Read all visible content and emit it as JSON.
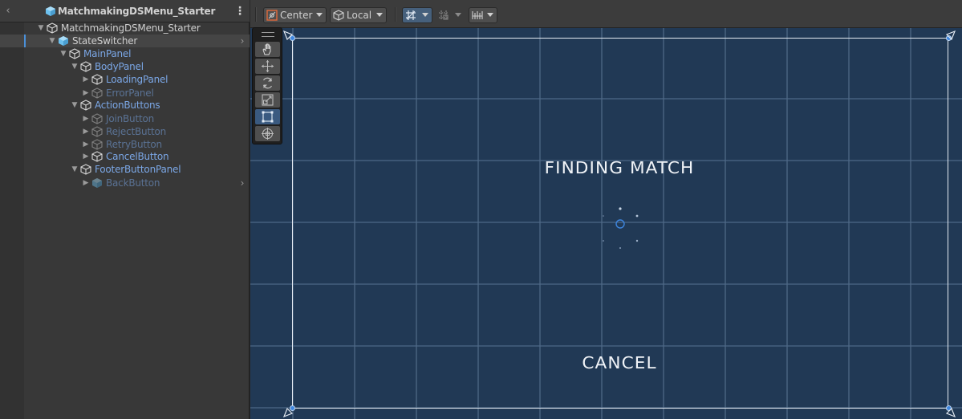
{
  "hierarchy": {
    "title": "MatchmakingDSMenu_Starter",
    "items": [
      {
        "label": "MatchmakingDSMenu_Starter",
        "depth": 0,
        "expanded": true,
        "color": "white",
        "icon": "gameobject-icon"
      },
      {
        "label": "StateSwitcher",
        "depth": 1,
        "expanded": true,
        "color": "white",
        "icon": "prefab-icon",
        "selected": true
      },
      {
        "label": "MainPanel",
        "depth": 2,
        "expanded": true,
        "color": "blue",
        "icon": "gameobject-icon"
      },
      {
        "label": "BodyPanel",
        "depth": 3,
        "expanded": true,
        "color": "blue",
        "icon": "gameobject-icon"
      },
      {
        "label": "LoadingPanel",
        "depth": 4,
        "expanded": false,
        "color": "blue",
        "icon": "gameobject-icon"
      },
      {
        "label": "ErrorPanel",
        "depth": 4,
        "expanded": false,
        "color": "dim",
        "icon": "gameobject-icon"
      },
      {
        "label": "ActionButtons",
        "depth": 3,
        "expanded": true,
        "color": "blue",
        "icon": "gameobject-icon"
      },
      {
        "label": "JoinButton",
        "depth": 4,
        "expanded": false,
        "color": "dim",
        "icon": "gameobject-icon"
      },
      {
        "label": "RejectButton",
        "depth": 4,
        "expanded": false,
        "color": "dim",
        "icon": "gameobject-icon"
      },
      {
        "label": "RetryButton",
        "depth": 4,
        "expanded": false,
        "color": "dim",
        "icon": "gameobject-icon"
      },
      {
        "label": "CancelButton",
        "depth": 4,
        "expanded": false,
        "color": "blue",
        "icon": "gameobject-icon"
      },
      {
        "label": "FooterButtonPanel",
        "depth": 3,
        "expanded": true,
        "color": "blue",
        "icon": "gameobject-icon"
      },
      {
        "label": "BackButton",
        "depth": 4,
        "expanded": false,
        "color": "dim",
        "icon": "prefab-icon"
      }
    ]
  },
  "toolbar": {
    "pivot_label": "Center",
    "space_label": "Local"
  },
  "scene": {
    "finding_text": "FINDING MATCH",
    "cancel_text": "CANCEL"
  },
  "tools": [
    "hand-tool",
    "move-tool",
    "rotate-tool",
    "scale-tool",
    "rect-tool",
    "transform-tool"
  ],
  "colors": {
    "scene_bg": "#213955",
    "accent": "#3e86df",
    "label_blue": "#7ba7e6"
  }
}
